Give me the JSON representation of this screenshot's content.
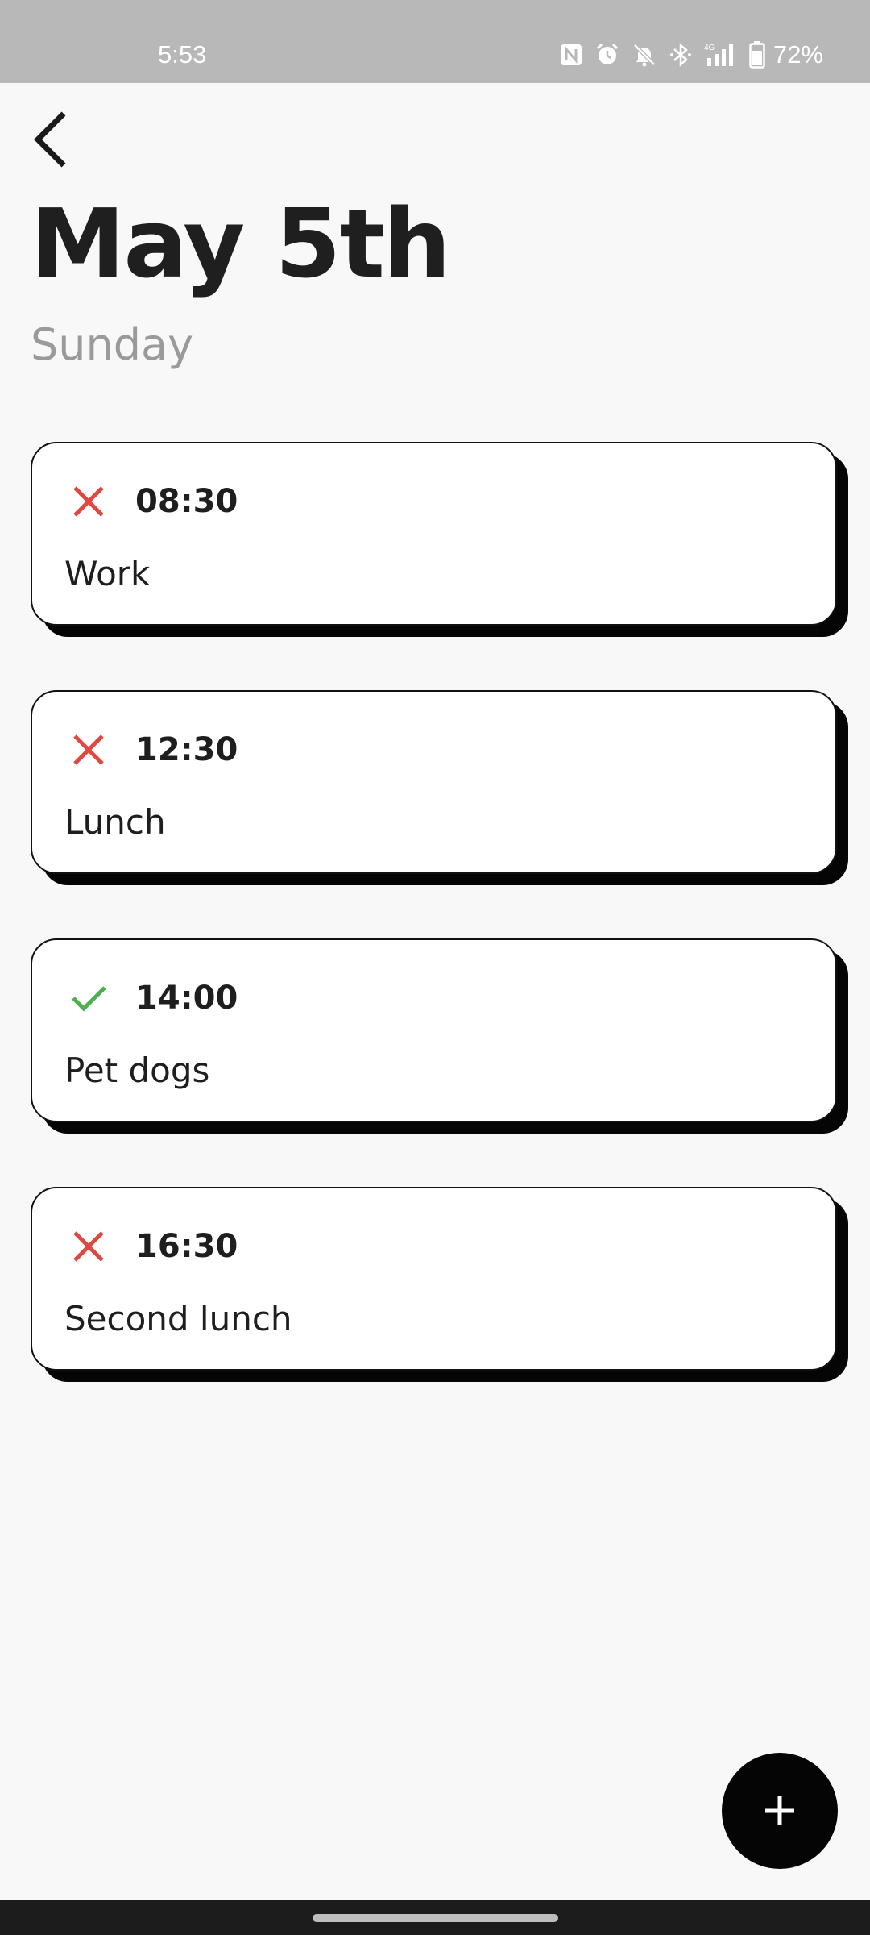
{
  "status_bar": {
    "time": "5:53",
    "battery": "72%",
    "icons": [
      "nfc-icon",
      "alarm-icon",
      "mute-icon",
      "bluetooth-icon",
      "signal-4g-icon",
      "battery-icon"
    ]
  },
  "header": {
    "back_icon": "chevron-left-icon",
    "title": "May 5th",
    "subtitle": "Sunday"
  },
  "tasks": [
    {
      "time": "08:30",
      "title": "Work",
      "done": false,
      "status_icon": "cross-icon"
    },
    {
      "time": "12:30",
      "title": "Lunch",
      "done": false,
      "status_icon": "cross-icon"
    },
    {
      "time": "14:00",
      "title": "Pet dogs",
      "done": true,
      "status_icon": "check-icon"
    },
    {
      "time": "16:30",
      "title": "Second lunch",
      "done": false,
      "status_icon": "cross-icon"
    }
  ],
  "fab": {
    "icon": "plus-icon"
  },
  "colors": {
    "not_done": "#e0473e",
    "done": "#4caf50",
    "status_bar": "#b8b8b8",
    "background": "#f8f8f8",
    "card_border": "#111111",
    "fab": "#050505"
  }
}
